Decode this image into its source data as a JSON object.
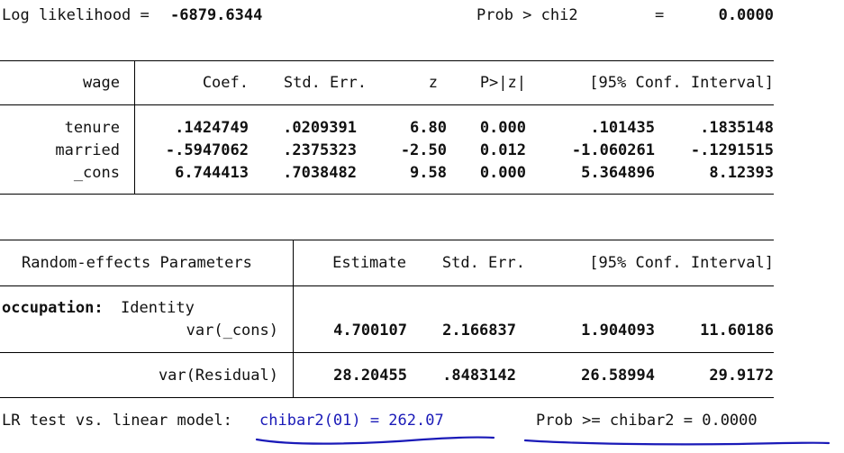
{
  "header": {
    "loglik_label": "Log likelihood = ",
    "loglik_value": "-6879.6344",
    "prob_label": "Prob > chi2",
    "prob_eq": "=",
    "prob_value": "0.0000"
  },
  "fixed": {
    "headers": [
      "wage",
      "Coef.",
      "Std. Err.",
      "z",
      "P>|z|",
      "[95% Conf. Interval]"
    ],
    "rows": [
      {
        "name": "tenure",
        "coef": ".1424749",
        "se": ".0209391",
        "z": "6.80",
        "p": "0.000",
        "lo": ".101435",
        "hi": ".1835148"
      },
      {
        "name": "married",
        "coef": "-.5947062",
        "se": ".2375323",
        "z": "-2.50",
        "p": "0.012",
        "lo": "-1.060261",
        "hi": "-.1291515"
      },
      {
        "name": "_cons",
        "coef": "6.744413",
        "se": ".7038482",
        "z": "9.58",
        "p": "0.000",
        "lo": "5.364896",
        "hi": "8.12393"
      }
    ]
  },
  "random": {
    "headers": [
      "Random-effects Parameters",
      "Estimate",
      "Std. Err.",
      "[95% Conf. Interval]"
    ],
    "group_label": "occupation:",
    "group_type": "Identity",
    "rows": [
      {
        "name": "var(_cons)",
        "est": "4.700107",
        "se": "2.166837",
        "lo": "1.904093",
        "hi": "11.60186"
      },
      {
        "name": "var(Residual)",
        "est": "28.20455",
        "se": ".8483142",
        "lo": "26.58994",
        "hi": "29.9172"
      }
    ]
  },
  "lrtest": {
    "label": "LR test vs. linear model: ",
    "stat": "chibar2(01) = 262.07",
    "prob": "Prob >= chibar2 = 0.0000"
  },
  "annotation_color": "#1a1ab8"
}
